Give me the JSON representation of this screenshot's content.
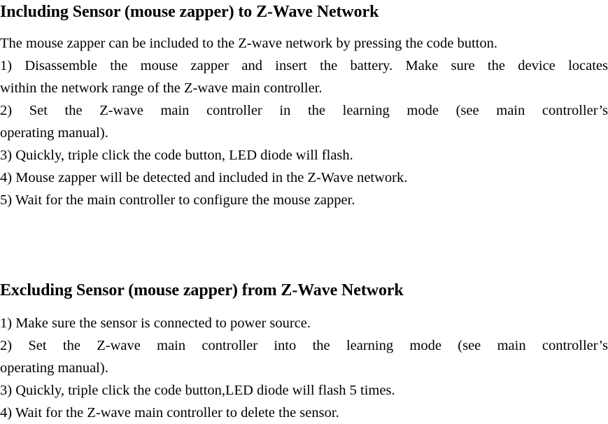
{
  "document": {
    "background_color": "#ffffff",
    "text_color": "#000000",
    "sections": [
      {
        "heading": "Including Sensor (mouse zapper) to Z-Wave Network",
        "lines": [
          "The mouse zapper can be included to the Z-wave network by pressing the code button.",
          "1) Disassemble the mouse zapper and insert the battery. Make sure the device locates",
          "within the network range of the Z-wave main controller.",
          "2) Set the Z-wave main controller in the learning mode (see main controller’s",
          "operating manual).",
          "3) Quickly, triple click the code button, LED diode will flash.",
          "4) Mouse zapper will be detected and included in the Z-Wave network.",
          "5) Wait for the main controller to configure the mouse zapper."
        ]
      },
      {
        "heading": "Excluding Sensor (mouse zapper) from Z-Wave Network",
        "lines": [
          "1) Make sure the sensor is connected to power source.",
          "2) Set the Z-wave main controller into the learning mode (see main controller’s",
          "operating manual).",
          "3) Quickly, triple click the code button,LED diode will flash 5 times.",
          "4) Wait for the Z-wave main controller to delete the sensor."
        ]
      }
    ]
  }
}
